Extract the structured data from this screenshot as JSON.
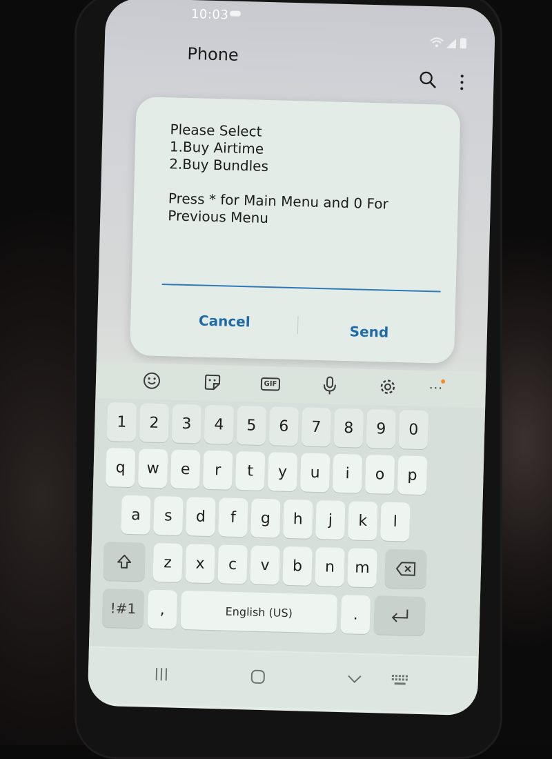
{
  "status_bar": {
    "time": "10:03"
  },
  "app_bar": {
    "title": "Phone",
    "search_icon": "search-icon",
    "more_icon": "more-vertical-icon"
  },
  "ussd_dialog": {
    "message": "Please Select\n1.Buy Airtime\n2.Buy Bundles\n\nPress  * for Main Menu and 0 For Previous Menu",
    "input_value": "",
    "cancel_label": "Cancel",
    "send_label": "Send",
    "accent_color": "#1f6aa8"
  },
  "keyboard_toolbar": {
    "icons": [
      "emoji-icon",
      "sticker-icon",
      "gif-icon",
      "microphone-icon",
      "settings-icon",
      "more-horizontal-icon"
    ],
    "gif_label": "GIF"
  },
  "keyboard": {
    "number_row": [
      "1",
      "2",
      "3",
      "4",
      "5",
      "6",
      "7",
      "8",
      "9",
      "0"
    ],
    "row1": [
      "q",
      "w",
      "e",
      "r",
      "t",
      "y",
      "u",
      "i",
      "o",
      "p"
    ],
    "row2": [
      "a",
      "s",
      "d",
      "f",
      "g",
      "h",
      "j",
      "k",
      "l"
    ],
    "row3": [
      "z",
      "x",
      "c",
      "v",
      "b",
      "n",
      "m"
    ],
    "symbols_label": "!#1",
    "comma_label": ",",
    "space_label": "English (US)",
    "period_label": "."
  },
  "nav_bar": {
    "icons": [
      "recent-apps-icon",
      "home-icon",
      "back-icon",
      "keyboard-toggle-icon"
    ]
  }
}
